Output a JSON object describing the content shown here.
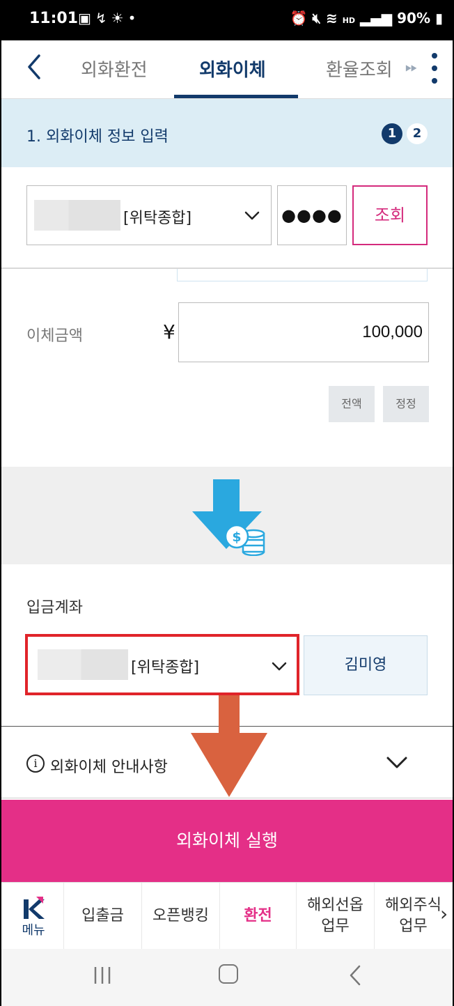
{
  "status_bar": {
    "time": "11:01",
    "left_icons": [
      "image-icon",
      "nfc-icon",
      "sun-icon",
      "dot-icon"
    ],
    "right_icons": [
      "alarm-icon",
      "mute-icon",
      "wifi-icon",
      "hd-voice-icon",
      "signal-icon"
    ],
    "battery": "90%"
  },
  "header": {
    "tabs": [
      {
        "label": "외화환전",
        "active": false
      },
      {
        "label": "외화이체",
        "active": true
      },
      {
        "label": "환율조회",
        "active": false
      }
    ]
  },
  "step": {
    "title": "1. 외화이체 정보 입력",
    "current": "1",
    "next": "2"
  },
  "source": {
    "account_type": "[위탁종합]",
    "password_mask": "●●●●",
    "lookup_label": "조회"
  },
  "amount": {
    "label": "이체금액",
    "currency_symbol": "¥",
    "value": "100,000",
    "all_label": "전액",
    "correct_label": "정정"
  },
  "deposit": {
    "label": "입금계좌",
    "account_type": "[위탁종합]",
    "holder": "김미영"
  },
  "notice": {
    "info_glyph": "i",
    "label": "외화이체 안내사항"
  },
  "execute_label": "외화이체 실행",
  "bottom_nav": {
    "menu_label": "메뉴",
    "items": [
      "입출금",
      "오픈뱅킹",
      "환전",
      "해외선옵\n업무",
      "해외주식\n업무"
    ],
    "active": "환전"
  },
  "colors": {
    "brand_navy": "#123a6b",
    "accent_pink": "#e42f87",
    "highlight_red": "#e0242a",
    "annotation_arrow": "#d9623f"
  }
}
